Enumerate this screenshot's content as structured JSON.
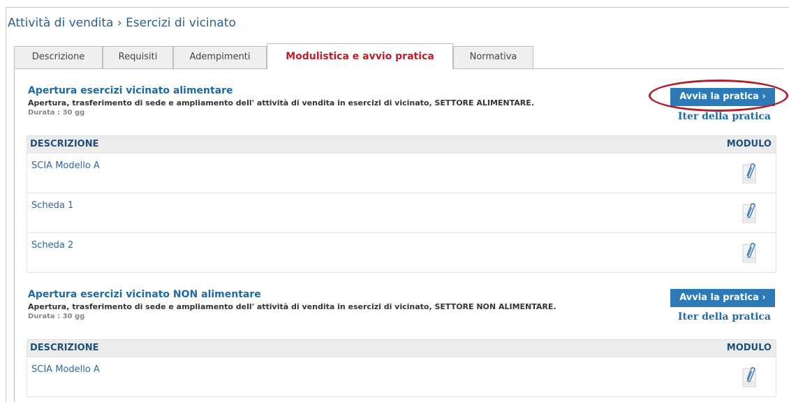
{
  "breadcrumb": "Attività di vendita › Esercizi di vicinato",
  "tabs": [
    "Descrizione",
    "Requisiti",
    "Adempimenti",
    "Modulistica e avvio pratica",
    "Normativa"
  ],
  "active_tab": "Modulistica e avvio pratica",
  "sections": [
    {
      "title": "Apertura esercizi vicinato alimentare",
      "subtitle": "Apertura, trasferimento di sede e ampliamento dell' attività di vendita in esercizi di vicinato, SETTORE ALIMENTARE.",
      "duration": "Durata : 30 gg",
      "avvia_label": "Avvia la pratica ›",
      "iter_label": "Iter della pratica",
      "table": {
        "header_desc": "DESCRIZIONE",
        "header_mod": "MODULO",
        "rows": [
          "SCIA Modello A",
          "Scheda 1",
          "Scheda 2"
        ]
      }
    },
    {
      "title": "Apertura esercizi vicinato NON alimentare",
      "subtitle": "Apertura, trasferimento di sede e ampliamento dell' attività di vendita in esercizi di vicinato, SETTORE NON ALIMENTARE.",
      "duration": "Durata : 30 gg",
      "avvia_label": "Avvia la pratica ›",
      "iter_label": "Iter della pratica",
      "table": {
        "header_desc": "DESCRIZIONE",
        "header_mod": "MODULO",
        "rows": [
          "SCIA Modello A"
        ]
      }
    }
  ],
  "colors": {
    "accent": "#2b7ab7",
    "link": "#1e6aa5",
    "active_tab": "#c01d2c",
    "highlight": "#b0202c"
  },
  "icons": {
    "attachment": "paperclip-icon"
  }
}
